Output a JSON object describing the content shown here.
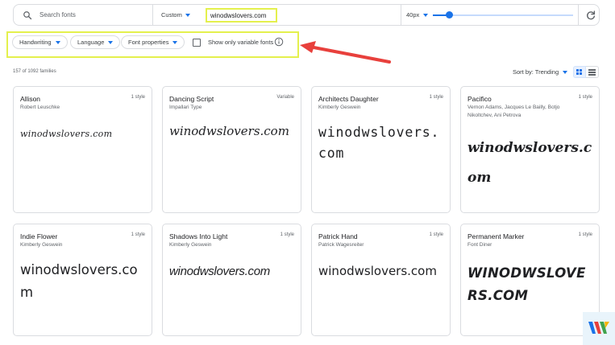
{
  "search": {
    "placeholder": "Search fonts"
  },
  "preview": {
    "mode": "Custom",
    "sample_text": "winodwslovers.com"
  },
  "size": {
    "label": "40px",
    "slider_value_fraction": 0.12
  },
  "filters": {
    "chips": [
      "Handwriting",
      "Language",
      "Font properties"
    ],
    "variable_checkbox_label": "Show only variable fonts",
    "variable_checked": false
  },
  "results": {
    "count_text": "157 of 1092 families",
    "sort_label": "Sort by: Trending"
  },
  "cards": [
    {
      "name": "Allison",
      "author": "Robert Leuschke",
      "styles": "1 style",
      "sample": "winodwslovers.com"
    },
    {
      "name": "Dancing Script",
      "author": "Impallari Type",
      "styles": "Variable",
      "sample": "winodwslovers.com"
    },
    {
      "name": "Architects Daughter",
      "author": "Kimberly Geswein",
      "styles": "1 style",
      "sample": "winodwslovers.com"
    },
    {
      "name": "Pacifico",
      "author": "Vernon Adams, Jacques Le Bailly, Botjo Nikoltchev, Ani Petrova",
      "styles": "1 style",
      "sample": "winodwslovers.com"
    },
    {
      "name": "Indie Flower",
      "author": "Kimberly Geswein",
      "styles": "1 style",
      "sample": "winodwslovers.com"
    },
    {
      "name": "Shadows Into Light",
      "author": "Kimberly Geswein",
      "styles": "1 style",
      "sample": "winodwslovers.com"
    },
    {
      "name": "Patrick Hand",
      "author": "Patrick Wagesreiter",
      "styles": "1 style",
      "sample": "winodwslovers.com"
    },
    {
      "name": "Permanent Marker",
      "author": "Font Diner",
      "styles": "1 style",
      "sample": "WINODWSLOVERS.COM"
    }
  ],
  "colors": {
    "accent": "#1a73e8",
    "highlight": "#e4f04d",
    "arrow": "#e8403c"
  },
  "icons": [
    "search-icon",
    "caret-down-icon",
    "refresh-icon",
    "info-icon",
    "grid-view-icon",
    "list-view-icon"
  ]
}
